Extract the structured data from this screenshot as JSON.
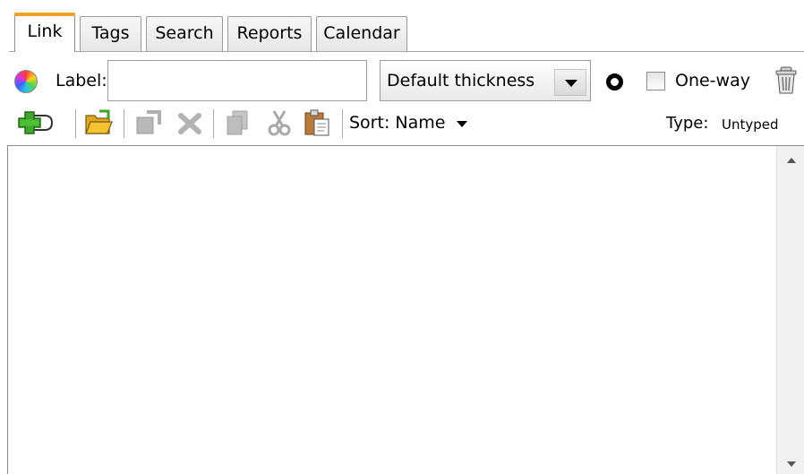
{
  "tabs": [
    {
      "label": "Link",
      "active": true
    },
    {
      "label": "Tags",
      "active": false
    },
    {
      "label": "Search",
      "active": false
    },
    {
      "label": "Reports",
      "active": false
    },
    {
      "label": "Calendar",
      "active": false
    }
  ],
  "label_row": {
    "color_icon": "color-wheel-icon",
    "label_text": "Label:",
    "label_value": "",
    "thickness_selected": "Default thickness",
    "line_style_icon": "ring-icon",
    "oneway_label": "One-way",
    "oneway_checked": false,
    "trash_icon": "trash-icon"
  },
  "toolbar": {
    "icons": [
      "add-link-icon",
      "open-folder-icon",
      "move-icon",
      "delete-icon",
      "copy-icon",
      "cut-icon",
      "paste-icon"
    ],
    "sort_label": "Sort: Name",
    "type_label": "Type:",
    "type_value": "Untyped"
  },
  "list": {
    "items": []
  },
  "colors": {
    "active_tab_accent": "#f0a030",
    "add_icon_green": "#3fa52b",
    "folder_yellow": "#f2c230"
  }
}
